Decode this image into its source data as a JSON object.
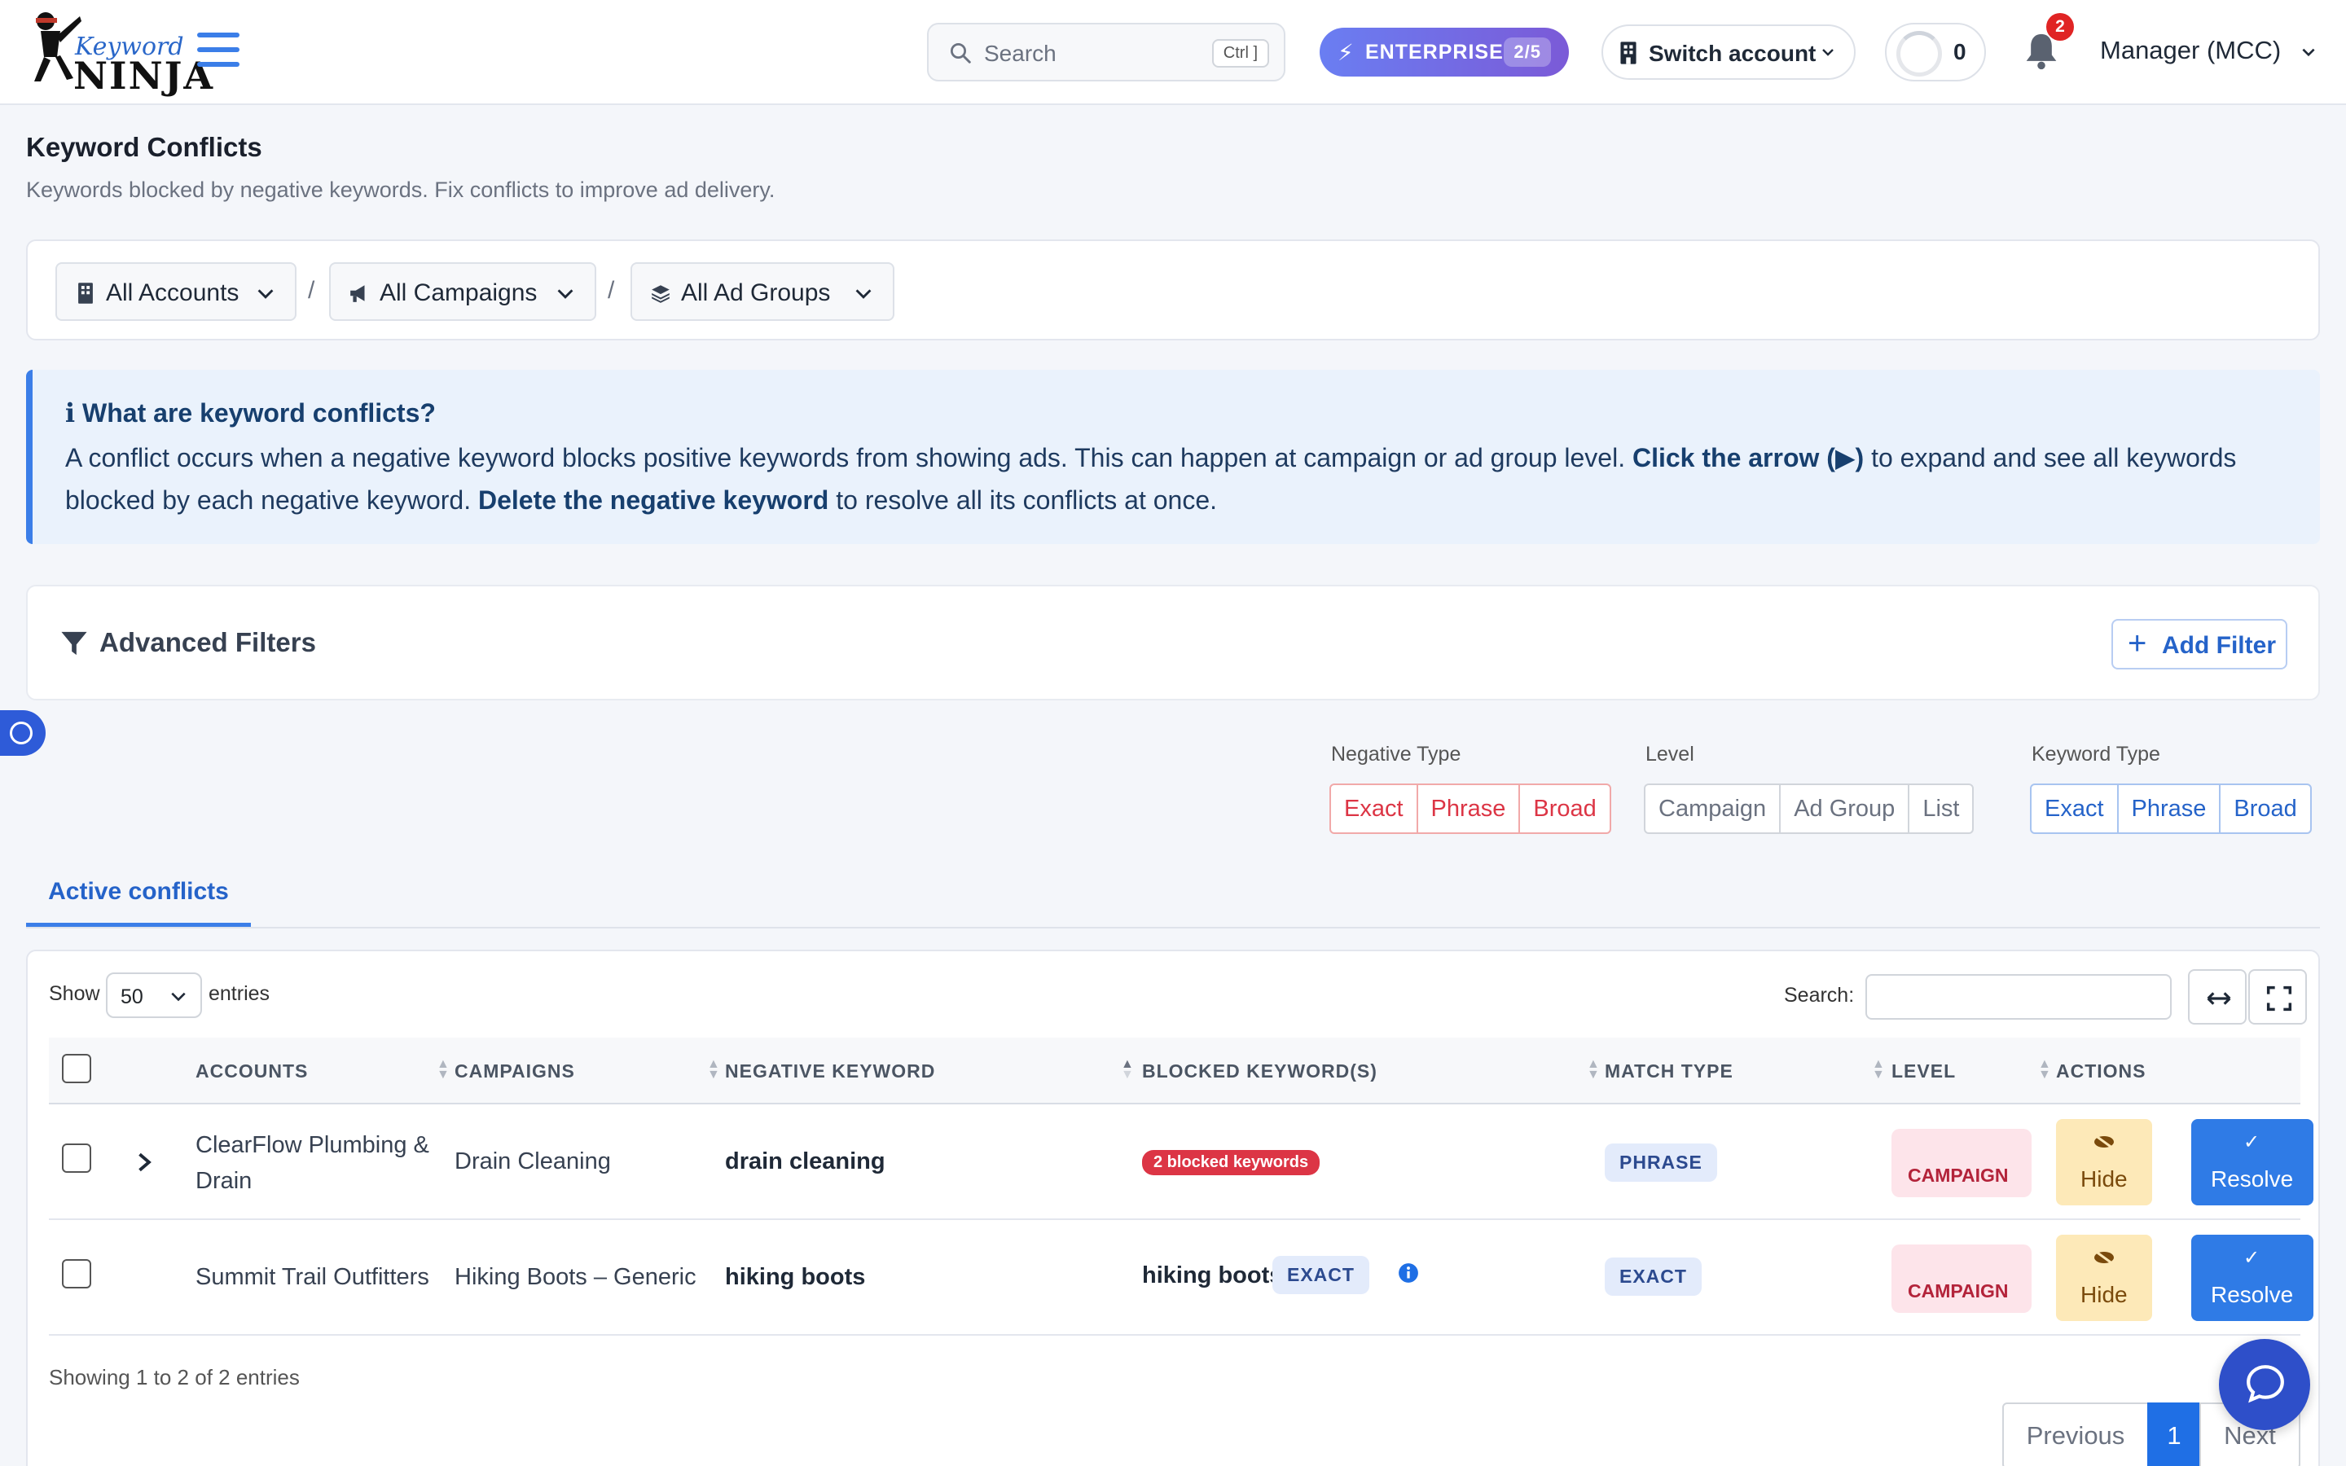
{
  "header": {
    "logo_top": "Keyword",
    "logo_bottom": "NINJA",
    "search_placeholder": "Search",
    "search_shortcut": "Ctrl ]",
    "plan_label": "ENTERPRISE",
    "plan_count": "2/5",
    "switch_account": "Switch account",
    "loader_count": "0",
    "notification_count": "2",
    "user_label": "Manager (MCC)"
  },
  "page": {
    "title": "Keyword Conflicts",
    "subtitle": "Keywords blocked by negative keywords. Fix conflicts to improve ad delivery."
  },
  "breadcrumb": {
    "accounts": "All Accounts",
    "campaigns": "All Campaigns",
    "ad_groups": "All Ad Groups",
    "separator": "/"
  },
  "info": {
    "title": "ℹ What are keyword conflicts?",
    "text_1": "A conflict occurs when a negative keyword blocks positive keywords from showing ads. This can happen at campaign or ad group level. ",
    "bold_1": "Click the arrow (▶)",
    "text_2": " to expand and see all keywords blocked by each negative keyword. ",
    "bold_2": "Delete the negative keyword",
    "text_3": " to resolve all its conflicts at once."
  },
  "advanced_filters": {
    "title": "Advanced Filters",
    "add_filter": "Add Filter"
  },
  "filters": {
    "negative_type": {
      "label": "Negative Type",
      "options": [
        "Exact",
        "Phrase",
        "Broad"
      ]
    },
    "level": {
      "label": "Level",
      "options": [
        "Campaign",
        "Ad Group",
        " List"
      ]
    },
    "keyword_type": {
      "label": "Keyword Type",
      "options": [
        "Exact",
        "Phrase",
        "Broad"
      ]
    }
  },
  "tabs": {
    "active": "Active conflicts"
  },
  "table": {
    "show_label": "Show",
    "page_size": "50",
    "entries_label": "entries",
    "search_label": "Search:",
    "columns": [
      "ACCOUNTS",
      "CAMPAIGNS",
      "NEGATIVE KEYWORD",
      "BLOCKED KEYWORD(S)",
      "MATCH TYPE",
      "LEVEL",
      "ACTIONS"
    ],
    "rows": [
      {
        "account_line1": "ClearFlow Plumbing &",
        "account_line2": "Drain",
        "campaign": "Drain Cleaning",
        "negative_keyword": "drain cleaning",
        "blocked_badge": "2 blocked keywords",
        "match_type": "PHRASE",
        "level_icon": "",
        "level": "CAMPAIGN",
        "hide": "Hide",
        "resolve": "Resolve"
      },
      {
        "account": "Summit Trail Outfitters",
        "campaign": "Hiking Boots – Generic",
        "negative_keyword": "hiking boots",
        "blocked_keyword": "hiking boots",
        "blocked_match": "EXACT",
        "match_type": "EXACT",
        "level_icon": "",
        "level": "CAMPAIGN",
        "hide": "Hide",
        "resolve": "Resolve"
      }
    ],
    "footer_info": "Showing 1 to 2 of 2 entries",
    "pager": {
      "previous": "Previous",
      "current": "1",
      "next": "Next"
    }
  },
  "colors": {
    "primary": "#2f7be6",
    "danger": "#dc3545",
    "enterprise_start": "#6a7ef2",
    "enterprise_end": "#7b5ad7"
  }
}
